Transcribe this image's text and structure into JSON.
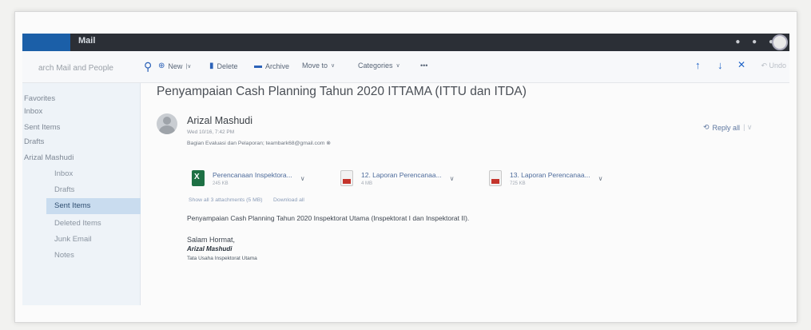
{
  "app": {
    "title": "Mail"
  },
  "search": {
    "placeholder": "Search Mail and People",
    "value": "arch Mail and People"
  },
  "toolbar": {
    "new_label": "New",
    "delete_label": "Delete",
    "archive_label": "Archive",
    "move_to_label": "Move to",
    "categories_label": "Categories",
    "more_label": "•••",
    "undo_label": "Undo"
  },
  "sidebar": {
    "favorites_label": "Favorites",
    "favorites": [
      "Inbox",
      "Sent Items",
      "Drafts"
    ],
    "account_label": "Arizal Mashudi",
    "folders": [
      "Inbox",
      "Drafts",
      "Sent Items",
      "Deleted Items",
      "Junk Email",
      "Notes"
    ],
    "selected_folder": "Sent Items"
  },
  "message": {
    "subject": "Penyampaian Cash Planning Tahun 2020 ITTAMA (ITTU dan ITDA)",
    "sender_name": "Arizal Mashudi",
    "sent_time": "Wed 10/16, 7:42 PM",
    "recipients": "Bagian Evaluasi dan Pelaporan; teambark68@gmail.com ⊗",
    "reply_label": "Reply all",
    "attachments": [
      {
        "name": "Perencanaan Inspektora...",
        "size": "245 KB",
        "type": "xls"
      },
      {
        "name": "12. Laporan Perencanaa...",
        "size": "4 MB",
        "type": "pdf"
      },
      {
        "name": "13. Laporan Perencanaa...",
        "size": "725 KB",
        "type": "pdf"
      }
    ],
    "show_all_label": "Show all 3 attachments (5 MB)",
    "download_all_label": "Download all",
    "body": "Penyampaian Cash Planning Tahun 2020 Inspektorat Utama (Inspektorat I dan Inspektorat II).",
    "greeting": "Salam Hormat,",
    "signature_name": "Arizal Mashudi",
    "signature_dept": "Tata Usaha Inspektorat Utama"
  },
  "colors": {
    "accent": "#2c62b8",
    "topbar": "#2b2f36",
    "sidebar_bg": "#eef3f8",
    "selected_bg": "#c9dcef"
  }
}
